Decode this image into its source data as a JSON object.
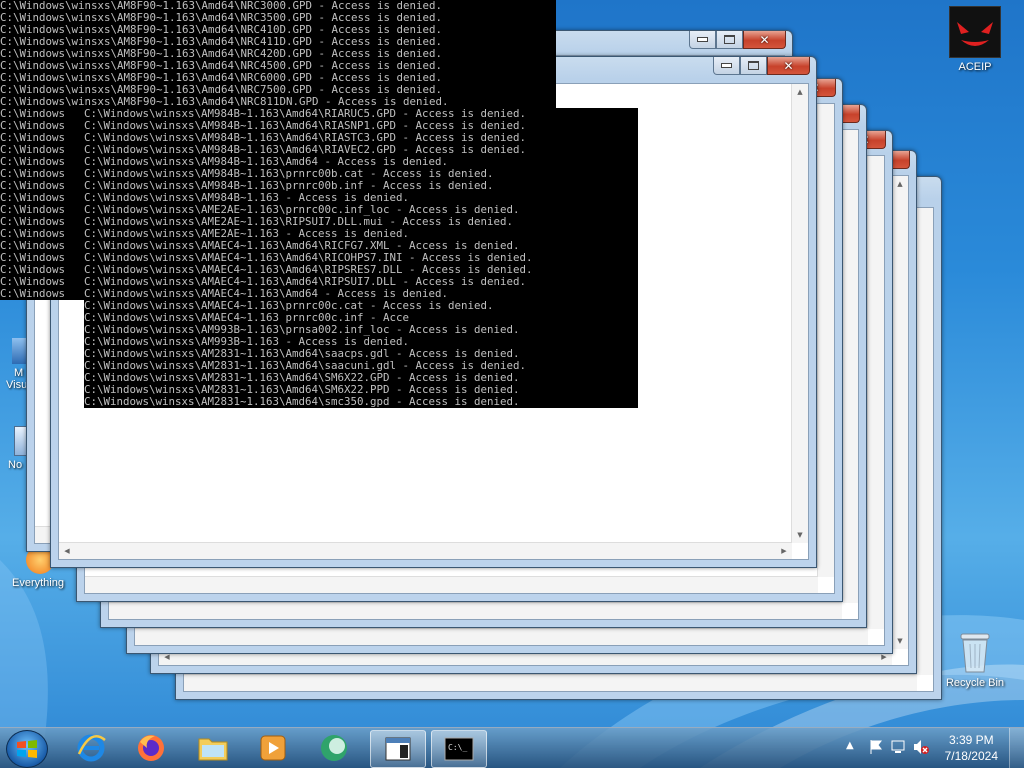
{
  "desktop": {
    "icons": [
      {
        "label": "ACEIP"
      },
      {
        "label": "M"
      },
      {
        "label": "Visu"
      },
      {
        "label": "No"
      },
      {
        "label": "Everything"
      },
      {
        "label": "Recycle Bin"
      }
    ]
  },
  "console_top": {
    "lines": [
      "C:\\Windows\\winsxs\\AM8F90~1.163\\Amd64\\NRC3000.GPD - Access is denied.",
      "C:\\Windows\\winsxs\\AM8F90~1.163\\Amd64\\NRC3500.GPD - Access is denied.",
      "C:\\Windows\\winsxs\\AM8F90~1.163\\Amd64\\NRC410D.GPD - Access is denied.",
      "C:\\Windows\\winsxs\\AM8F90~1.163\\Amd64\\NRC411D.GPD - Access is denied.",
      "C:\\Windows\\winsxs\\AM8F90~1.163\\Amd64\\NRC420D.GPD - Access is denied.",
      "C:\\Windows\\winsxs\\AM8F90~1.163\\Amd64\\NRC4500.GPD - Access is denied.",
      "C:\\Windows\\winsxs\\AM8F90~1.163\\Amd64\\NRC6000.GPD - Access is denied.",
      "C:\\Windows\\winsxs\\AM8F90~1.163\\Amd64\\NRC7500.GPD - Access is denied.",
      "C:\\Windows\\winsxs\\AM8F90~1.163\\Amd64\\NRC811DN.GPD - Access is denied."
    ],
    "clipped_prefix": "C:\\Windows"
  },
  "console_main": {
    "lines": [
      "C:\\Windows\\winsxs\\AM984B~1.163\\Amd64\\RIARUC5.GPD - Access is denied.",
      "C:\\Windows\\winsxs\\AM984B~1.163\\Amd64\\RIASNP1.GPD - Access is denied.",
      "C:\\Windows\\winsxs\\AM984B~1.163\\Amd64\\RIASTC3.GPD - Access is denied.",
      "C:\\Windows\\winsxs\\AM984B~1.163\\Amd64\\RIAVEC2.GPD - Access is denied.",
      "C:\\Windows\\winsxs\\AM984B~1.163\\Amd64 - Access is denied.",
      "C:\\Windows\\winsxs\\AM984B~1.163\\prnrc00b.cat - Access is denied.",
      "C:\\Windows\\winsxs\\AM984B~1.163\\prnrc00b.inf - Access is denied.",
      "C:\\Windows\\winsxs\\AM984B~1.163 - Access is denied.",
      "C:\\Windows\\winsxs\\AME2AE~1.163\\prnrc00c.inf_loc - Access is denied.",
      "C:\\Windows\\winsxs\\AME2AE~1.163\\RIPSUI7.DLL.mui - Access is denied.",
      "C:\\Windows\\winsxs\\AME2AE~1.163 - Access is denied.",
      "C:\\Windows\\winsxs\\AMAEC4~1.163\\Amd64\\RICFG7.XML - Access is denied.",
      "C:\\Windows\\winsxs\\AMAEC4~1.163\\Amd64\\RICOHPS7.INI - Access is denied.",
      "C:\\Windows\\winsxs\\AMAEC4~1.163\\Amd64\\RIPSRES7.DLL - Access is denied.",
      "C:\\Windows\\winsxs\\AMAEC4~1.163\\Amd64\\RIPSUI7.DLL - Access is denied.",
      "C:\\Windows\\winsxs\\AMAEC4~1.163\\Amd64 - Access is denied.",
      "C:\\Windows\\winsxs\\AMAEC4~1.163\\prnrc00c.cat - Access is denied.",
      "C:\\Windows\\winsxs\\AMAEC4~1.163 prnrc00c.inf - Acce",
      "C:\\Windows\\winsxs\\AM993B~1.163\\prnsa002.inf_loc - Access is denied.",
      "C:\\Windows\\winsxs\\AM993B~1.163 - Access is denied.",
      "C:\\Windows\\winsxs\\AM2831~1.163\\Amd64\\saacps.gdl - Access is denied.",
      "C:\\Windows\\winsxs\\AM2831~1.163\\Amd64\\saacuni.gdl - Access is denied.",
      "C:\\Windows\\winsxs\\AM2831~1.163\\Amd64\\SM6X22.GPD - Access is denied.",
      "C:\\Windows\\winsxs\\AM2831~1.163\\Amd64\\SM6X22.PPD - Access is denied.",
      "C:\\Windows\\winsxs\\AM2831~1.163\\Amd64\\smc350.gpd - Access is denied."
    ]
  },
  "taskbar": {
    "pinned": [
      "internet-explorer",
      "firefox",
      "file-explorer",
      "media-player",
      "app-globe",
      "window-app",
      "command-prompt"
    ],
    "clock_time": "3:39 PM",
    "clock_date": "7/18/2024"
  },
  "colors": {
    "console_text": "#c0c0c0",
    "console_bg": "#000000",
    "desktop_blue": "#2a8ad9"
  }
}
